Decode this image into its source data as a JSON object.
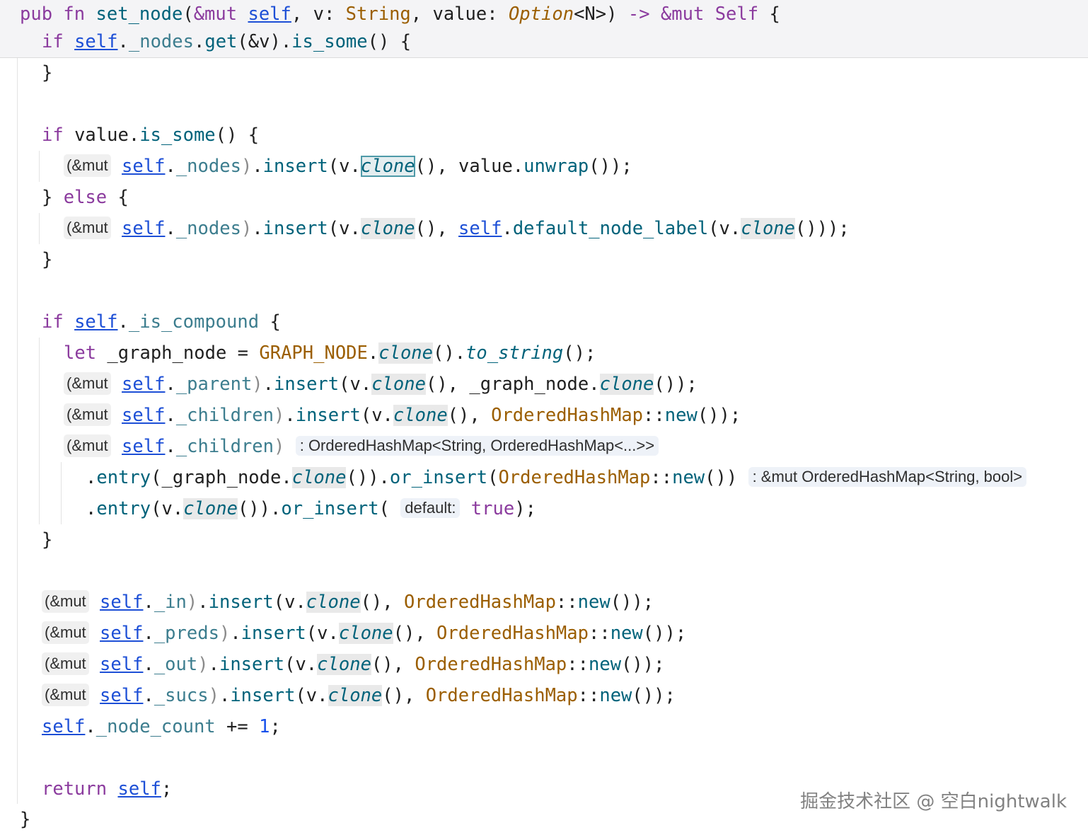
{
  "code": {
    "sticky_line_1": "pub fn set_node(&mut self, v: String, value: Option<N>) -> &mut Self {",
    "sticky_line_2": "if self._nodes.get(&v).is_some() {",
    "lines": [
      "}",
      "",
      "if value.is_some() {",
      "self._nodes).insert(v.clone(), value.unwrap());",
      "} else {",
      "self._nodes).insert(v.clone(), self.default_node_label(v.clone()));",
      "}",
      "",
      "if self._is_compound {",
      "let _graph_node = GRAPH_NODE.clone().to_string();",
      "self._parent).insert(v.clone(), _graph_node.clone());",
      "self._children).insert(v.clone(), OrderedHashMap::new());",
      "self._children)",
      ".entry(_graph_node.clone()).or_insert(OrderedHashMap::new())",
      ".entry(v.clone()).or_insert( true);",
      "}",
      "",
      "self._in).insert(v.clone(), OrderedHashMap::new());",
      "self._preds).insert(v.clone(), OrderedHashMap::new());",
      "self._out).insert(v.clone(), OrderedHashMap::new());",
      "self._sucs).insert(v.clone(), OrderedHashMap::new());",
      "self._node_count += 1;",
      "",
      "return self;",
      "}"
    ]
  },
  "hints": {
    "mut_prefix": "(&mut",
    "children_type": ": OrderedHashMap<String, OrderedHashMap<...>>",
    "entry_type": ": &mut OrderedHashMap<String, bool>",
    "param_default": "default:"
  },
  "watermark": "掘金技术社区 @ 空白nightwalk"
}
